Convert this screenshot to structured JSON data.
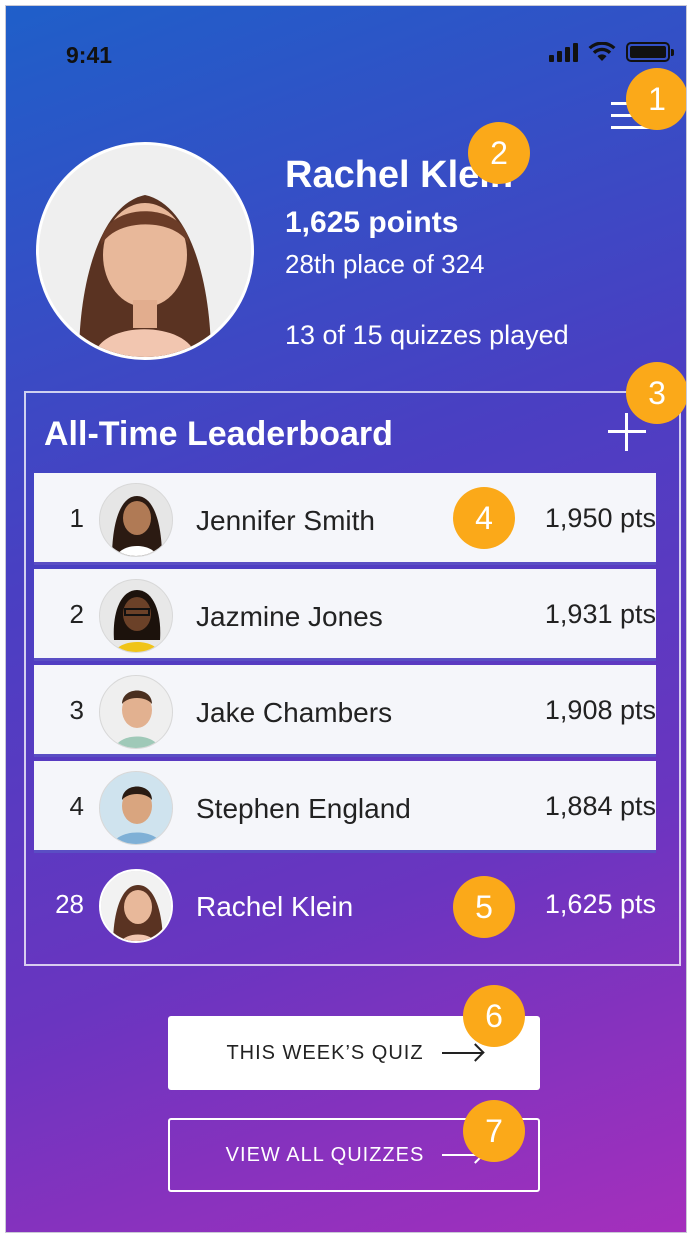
{
  "status_bar": {
    "time": "9:41"
  },
  "callouts": [
    "1",
    "2",
    "3",
    "4",
    "5",
    "6",
    "7"
  ],
  "profile": {
    "name": "Rachel Klein",
    "points": "1,625 points",
    "rank": "28th place of 324",
    "quizzes": "13 of 15 quizzes played"
  },
  "leaderboard": {
    "title": "All-Time Leaderboard",
    "rows": [
      {
        "rank": "1",
        "name": "Jennifer Smith",
        "points": "1,950 pts"
      },
      {
        "rank": "2",
        "name": "Jazmine Jones",
        "points": "1,931 pts"
      },
      {
        "rank": "3",
        "name": "Jake Chambers",
        "points": "1,908 pts"
      },
      {
        "rank": "4",
        "name": "Stephen England",
        "points": "1,884 pts"
      }
    ],
    "self_row": {
      "rank": "28",
      "name": "Rachel Klein",
      "points": "1,625 pts"
    }
  },
  "buttons": {
    "this_week": "THIS WEEK’S QUIZ",
    "view_all": "VIEW ALL QUIZZES"
  },
  "colors": {
    "gradient_top": "#1f5fc9",
    "gradient_bottom": "#a52fbc",
    "callout": "#fba919"
  }
}
